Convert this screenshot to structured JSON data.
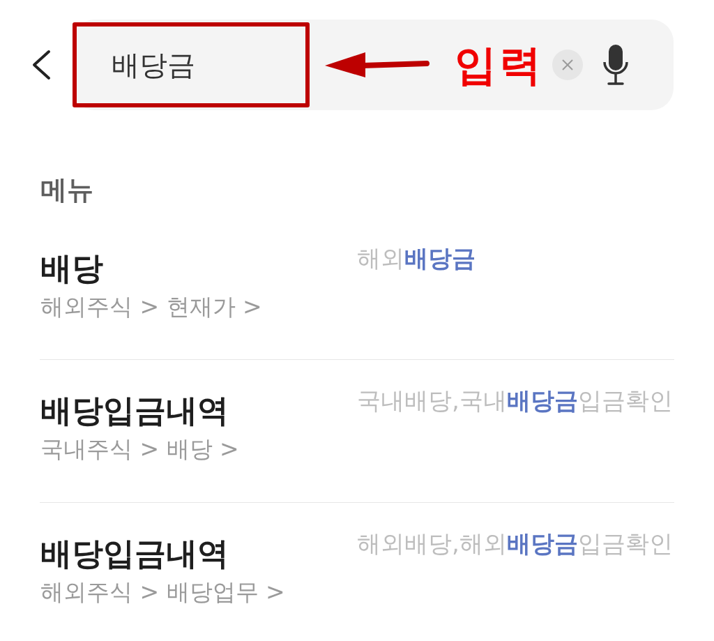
{
  "search": {
    "value": "배당금"
  },
  "annotation": {
    "label": "입력"
  },
  "section": {
    "title": "메뉴"
  },
  "results": [
    {
      "title": "배당",
      "path": "해외주식 > 현재가 >",
      "keywords": "해외**배당금**"
    },
    {
      "title": "배당입금내역",
      "path": "국내주식 > 배당 >",
      "keywords": "국내배당,국내**배당금**입금확인"
    },
    {
      "title": "배당입금내역",
      "path": "해외주식 > 배당업무 >",
      "keywords": "해외배당,해외**배당금**입금확인"
    }
  ]
}
